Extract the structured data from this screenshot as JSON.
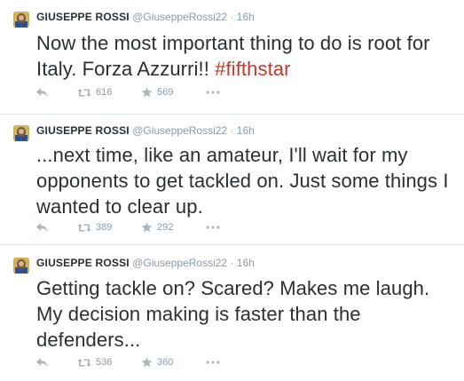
{
  "tweets": [
    {
      "name": "GIUSEPPE ROSSI",
      "handle": "@GiuseppeRossi22",
      "separator": "·",
      "time": "16h",
      "text": "Now the most important thing to do  is root for Italy. Forza Azzurri!! ",
      "hashtag": "#fifthstar",
      "retweets": "616",
      "favorites": "569"
    },
    {
      "name": "GIUSEPPE ROSSI",
      "handle": "@GiuseppeRossi22",
      "separator": "·",
      "time": "16h",
      "text": "...next time, like an amateur, I'll wait for my opponents to get tackled on. Just some things I wanted to clear up.",
      "hashtag": "",
      "retweets": "389",
      "favorites": "292"
    },
    {
      "name": "GIUSEPPE ROSSI",
      "handle": "@GiuseppeRossi22",
      "separator": "·",
      "time": "16h",
      "text": "Getting tackle on? Scared? Makes me laugh. My decision making is faster than the defenders...",
      "hashtag": "",
      "retweets": "536",
      "favorites": "360"
    }
  ],
  "icons": {
    "reply": "reply-icon",
    "retweet": "retweet-icon",
    "favorite": "star-icon",
    "more": "more-icon",
    "avatar": "avatar"
  },
  "colors": {
    "text": "#292f33",
    "meta": "#8899a6",
    "hashtag": "#c0392b",
    "divider": "#e1e8ed"
  }
}
